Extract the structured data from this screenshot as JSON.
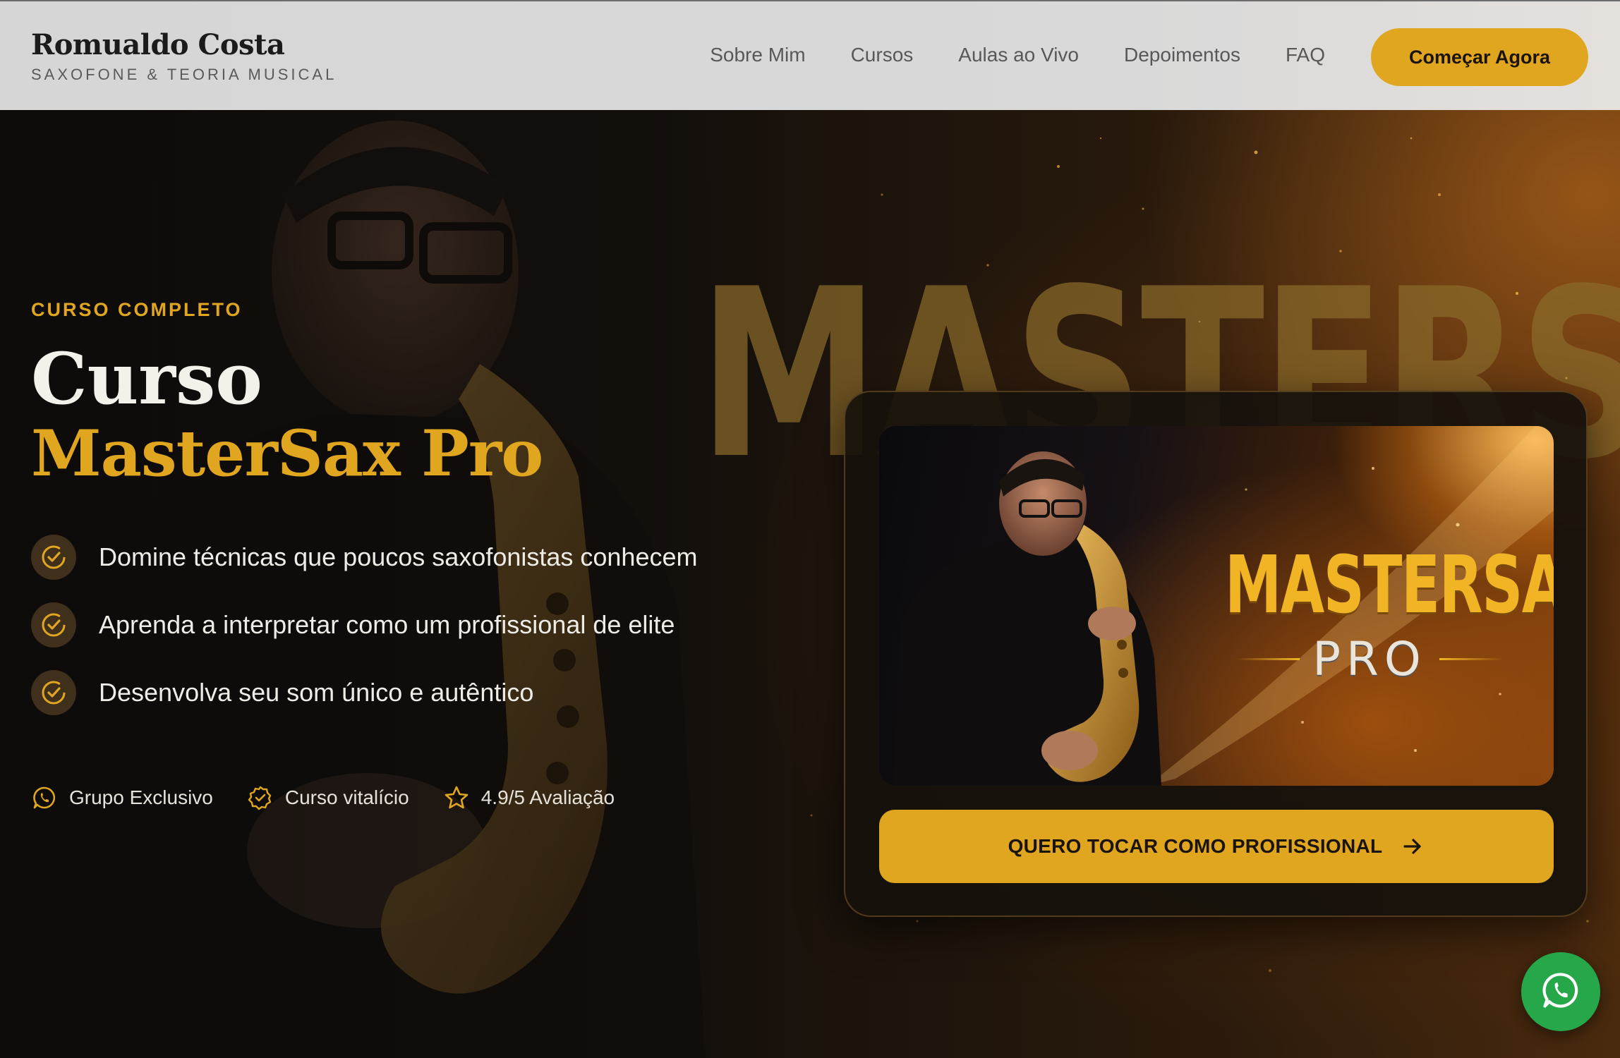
{
  "header": {
    "brand_name": "Romualdo Costa",
    "brand_sub": "SAXOFONE & TEORIA MUSICAL",
    "nav": [
      "Sobre Mim",
      "Cursos",
      "Aulas ao Vivo",
      "Depoimentos",
      "FAQ"
    ],
    "cta_label": "Começar Agora"
  },
  "hero": {
    "background_word": "MASTERSAX",
    "eyebrow": "CURSO COMPLETO",
    "title_line1": "Curso",
    "title_line2": "MasterSax Pro",
    "features": [
      "Domine técnicas que poucos saxofonistas conhecem",
      "Aprenda a interpretar como um profissional de elite",
      "Desenvolva seu som único e autêntico"
    ],
    "feature_icon": "check-circle-icon",
    "badges": [
      {
        "icon": "whatsapp-icon",
        "label": "Grupo Exclusivo"
      },
      {
        "icon": "badge-check-icon",
        "label": "Curso vitalício"
      },
      {
        "icon": "star-icon",
        "label": "4.9/5 Avaliação"
      }
    ]
  },
  "card": {
    "cover_title": "MASTERSAX",
    "cover_sub": "PRO",
    "cta_label": "QUERO TOCAR COMO PROFISSIONAL",
    "cta_icon": "arrow-right-icon"
  },
  "fab": {
    "icon": "whatsapp-icon"
  },
  "colors": {
    "accent": "#e0a61f",
    "header_bg": "#d9d9d9",
    "hero_bg": "#120d08",
    "fab": "#25a74a",
    "text_light": "#efece6"
  }
}
